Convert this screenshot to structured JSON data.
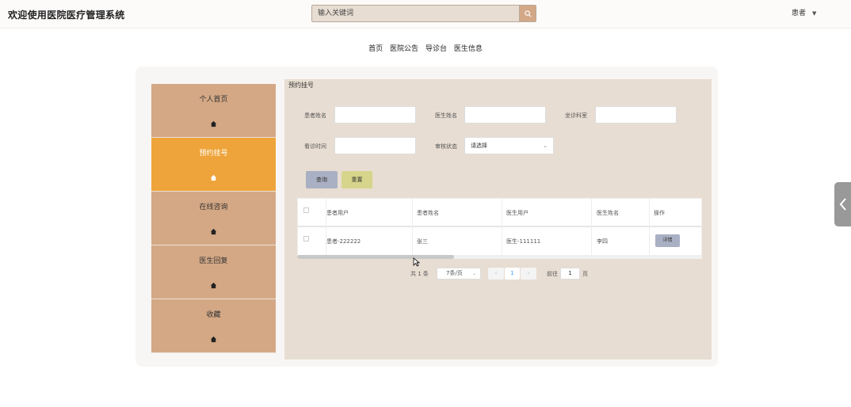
{
  "header": {
    "title": "欢迎使用医院医疗管理系统",
    "search_placeholder": "输入关键词",
    "search_icon": "search-icon",
    "user_label": "患者"
  },
  "topnav": [
    "首页",
    "医院公告",
    "导诊台",
    "医生信息"
  ],
  "sidebar": {
    "items": [
      {
        "label": "个人首页",
        "icon": "home-icon",
        "active": false
      },
      {
        "label": "预约挂号",
        "icon": "home-icon",
        "active": true
      },
      {
        "label": "在线咨询",
        "icon": "home-icon",
        "active": false
      },
      {
        "label": "医生回复",
        "icon": "home-icon",
        "active": false
      },
      {
        "label": "收藏",
        "icon": "home-icon",
        "active": false
      }
    ]
  },
  "content": {
    "title": "预约挂号",
    "filters": {
      "patient_name_label": "患者姓名",
      "doctor_name_label": "医生姓名",
      "department_label": "坐诊科室",
      "visit_time_label": "看诊时间",
      "review_status_label": "审核状态",
      "review_status_value": "请选择"
    },
    "buttons": {
      "query": "查询",
      "reset": "重置"
    },
    "table": {
      "headers": [
        "患者用户",
        "患者姓名",
        "医生用户",
        "医生姓名",
        "操作"
      ],
      "rows": [
        {
          "patient_user": "患者-222222",
          "patient_name": "张三",
          "doctor_user": "医生-111111",
          "doctor_name": "李四",
          "action": "详情"
        }
      ]
    },
    "pagination": {
      "total": "共 1 条",
      "page_size": "7条/页",
      "prev": "‹",
      "current_page": "1",
      "next": "›",
      "goto_prefix": "前往",
      "goto_value": "1",
      "goto_suffix": "页"
    }
  },
  "colors": {
    "sidebar_bg": "#d4a885",
    "sidebar_active": "#eea43a",
    "content_bg": "#e8ddd2",
    "query_button": "#aab0c3",
    "reset_button": "#d7d58b"
  }
}
